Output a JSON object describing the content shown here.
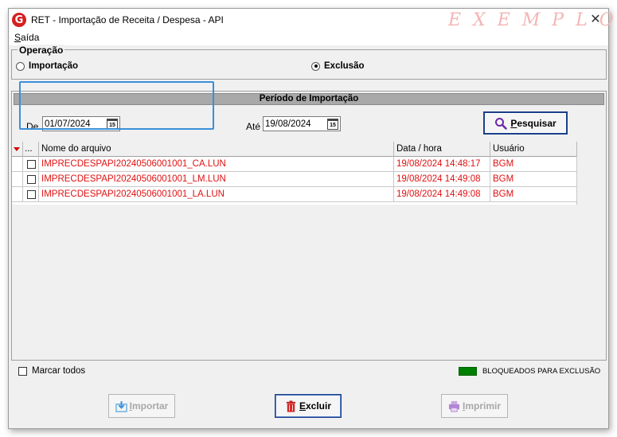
{
  "window": {
    "title": "RET - Importação de Receita / Despesa - API",
    "watermark": "EXEMPLO",
    "app_icon": "G"
  },
  "menu": {
    "items": [
      {
        "label": "Saída"
      }
    ]
  },
  "operation": {
    "legend": "Operação",
    "options": [
      {
        "label": "Importação",
        "selected": false
      },
      {
        "label": "Exclusão",
        "selected": true
      }
    ]
  },
  "period": {
    "header": "Período de Importação",
    "from_label": "De",
    "from_value": "01/07/2024",
    "to_label": "Até",
    "to_value": "19/08/2024",
    "calendar_glyph": "15",
    "search_label": "Pesquisar"
  },
  "grid": {
    "columns": [
      "...",
      "Nome do arquivo",
      "Data / hora",
      "Usuário"
    ],
    "rows": [
      {
        "checked": false,
        "file": "IMPRECDESPAPI20240506001001_CA.LUN",
        "datetime": "19/08/2024 14:48:17",
        "user": "BGM"
      },
      {
        "checked": false,
        "file": "IMPRECDESPAPI20240506001001_LM.LUN",
        "datetime": "19/08/2024 14:49:08",
        "user": "BGM"
      },
      {
        "checked": false,
        "file": "IMPRECDESPAPI20240506001001_LA.LUN",
        "datetime": "19/08/2024 14:49:08",
        "user": "BGM"
      }
    ]
  },
  "footer": {
    "select_all_label": "Marcar todos",
    "legend_label": "BLOQUEADOS PARA EXCLUSÃO",
    "legend_color": "#008000"
  },
  "buttons": {
    "import_label": "Importar",
    "delete_label": "Excluir",
    "print_label": "Imprimir"
  },
  "colors": {
    "row_text": "#e01010",
    "accent": "#1a3f8a",
    "highlight": "#3a8fd8"
  }
}
